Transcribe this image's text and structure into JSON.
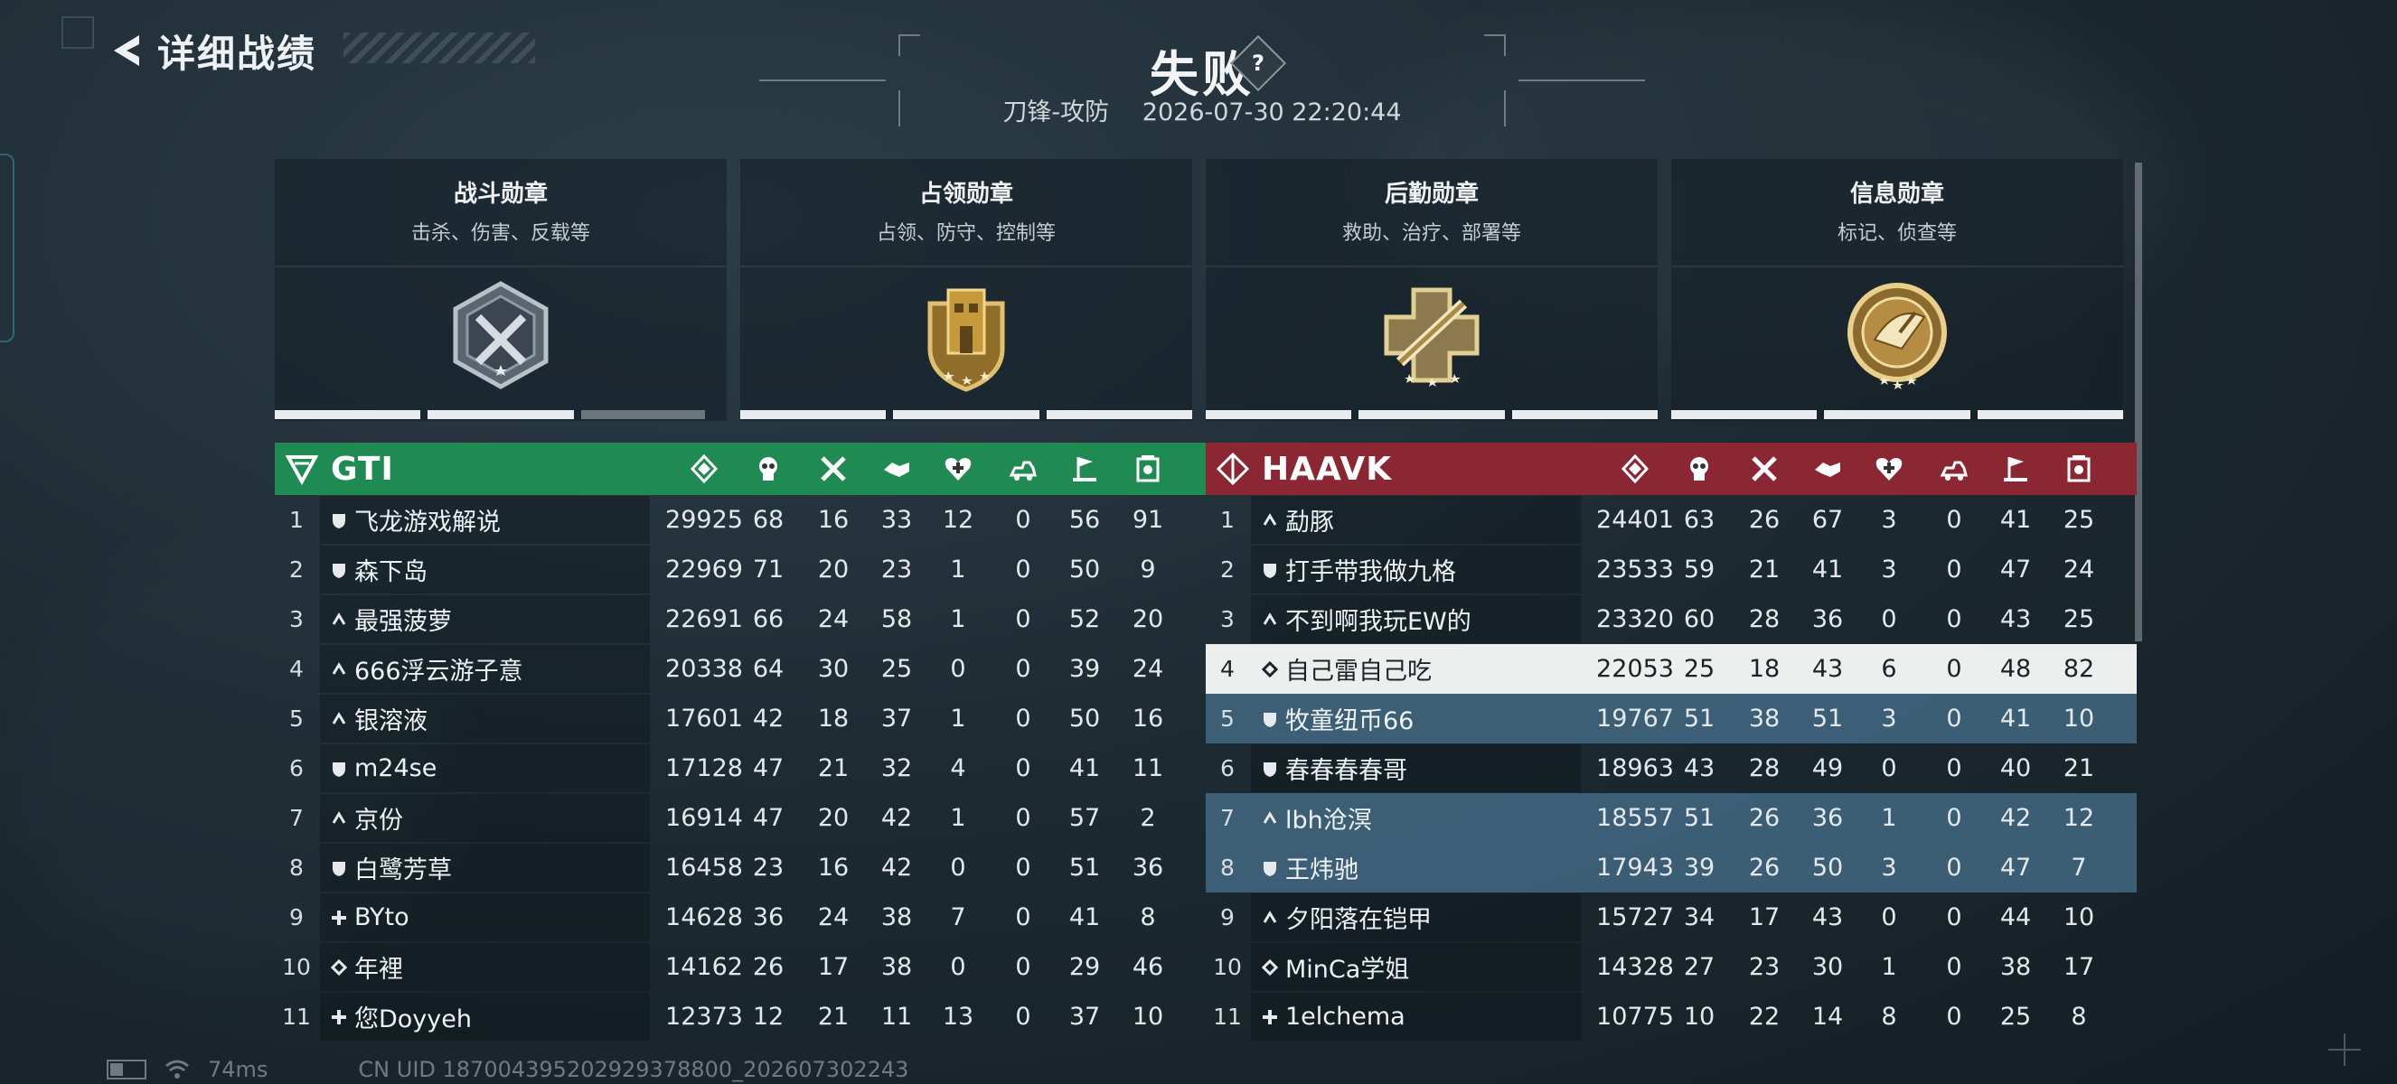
{
  "header": {
    "back_label": "详细战绩",
    "result": "失败",
    "help": "?",
    "mode": "刀锋-攻防",
    "datetime": "2026-07-30 22:20:44"
  },
  "medals": [
    {
      "title": "战斗勋章",
      "desc": "击杀、伤害、反载等",
      "icon": "combat-medal-icon",
      "progress": [
        1,
        1,
        0.85
      ]
    },
    {
      "title": "占领勋章",
      "desc": "占领、防守、控制等",
      "icon": "capture-medal-icon",
      "progress": [
        1,
        1,
        1
      ]
    },
    {
      "title": "后勤勋章",
      "desc": "救助、治疗、部署等",
      "icon": "logistics-medal-icon",
      "progress": [
        1,
        1,
        1
      ]
    },
    {
      "title": "信息勋章",
      "desc": "标记、侦查等",
      "icon": "intel-medal-icon",
      "progress": [
        1,
        1,
        1
      ]
    }
  ],
  "stat_icons": [
    "score-icon",
    "kill-icon",
    "death-icon",
    "assist-icon",
    "revive-icon",
    "vehicle-icon",
    "capture-icon",
    "intel-icon"
  ],
  "team_a": {
    "name": "GTI",
    "color": "#1f8a52",
    "players": [
      {
        "idx": "1",
        "rank": "shield",
        "name": "飞龙游戏解说",
        "stats": [
          "29925",
          "68",
          "16",
          "33",
          "12",
          "0",
          "56",
          "91"
        ]
      },
      {
        "idx": "2",
        "rank": "shield",
        "name": "森下岛",
        "stats": [
          "22969",
          "71",
          "20",
          "23",
          "1",
          "0",
          "50",
          "9"
        ]
      },
      {
        "idx": "3",
        "rank": "chevron",
        "name": "最强菠萝",
        "stats": [
          "22691",
          "66",
          "24",
          "58",
          "1",
          "0",
          "52",
          "20"
        ]
      },
      {
        "idx": "4",
        "rank": "chevron",
        "name": "666浮云游子意",
        "stats": [
          "20338",
          "64",
          "30",
          "25",
          "0",
          "0",
          "39",
          "24"
        ]
      },
      {
        "idx": "5",
        "rank": "chevron",
        "name": "银溶液",
        "stats": [
          "17601",
          "42",
          "18",
          "37",
          "1",
          "0",
          "50",
          "16"
        ]
      },
      {
        "idx": "6",
        "rank": "shield",
        "name": "m24se",
        "stats": [
          "17128",
          "47",
          "21",
          "32",
          "4",
          "0",
          "41",
          "11"
        ]
      },
      {
        "idx": "7",
        "rank": "chevron",
        "name": "京份",
        "stats": [
          "16914",
          "47",
          "20",
          "42",
          "1",
          "0",
          "57",
          "2"
        ]
      },
      {
        "idx": "8",
        "rank": "shield",
        "name": "白鹭芳草",
        "stats": [
          "16458",
          "23",
          "16",
          "42",
          "0",
          "0",
          "51",
          "36"
        ]
      },
      {
        "idx": "9",
        "rank": "cross",
        "name": "BYto",
        "stats": [
          "14628",
          "36",
          "24",
          "38",
          "7",
          "0",
          "41",
          "8"
        ]
      },
      {
        "idx": "10",
        "rank": "diamond",
        "name": "年裡",
        "stats": [
          "14162",
          "26",
          "17",
          "38",
          "0",
          "0",
          "29",
          "46"
        ]
      },
      {
        "idx": "11",
        "rank": "cross",
        "name": "您Doyyeh",
        "stats": [
          "12373",
          "12",
          "21",
          "11",
          "13",
          "0",
          "37",
          "10"
        ]
      }
    ]
  },
  "team_b": {
    "name": "HAAVK",
    "color": "#8a2733",
    "players": [
      {
        "idx": "1",
        "rank": "chevron",
        "name": "勐豚",
        "stats": [
          "24401",
          "63",
          "26",
          "67",
          "3",
          "0",
          "41",
          "25"
        ]
      },
      {
        "idx": "2",
        "rank": "shield",
        "name": "打手带我做九格",
        "stats": [
          "23533",
          "59",
          "21",
          "41",
          "3",
          "0",
          "47",
          "24"
        ]
      },
      {
        "idx": "3",
        "rank": "chevron",
        "name": "不到啊我玩EW的",
        "stats": [
          "23320",
          "60",
          "28",
          "36",
          "0",
          "0",
          "43",
          "25"
        ]
      },
      {
        "idx": "4",
        "rank": "diamond",
        "name": "自己雷自己吃",
        "stats": [
          "22053",
          "25",
          "18",
          "43",
          "6",
          "0",
          "48",
          "82"
        ],
        "highlight": true
      },
      {
        "idx": "5",
        "rank": "shield",
        "name": "牧童纽币66",
        "stats": [
          "19767",
          "51",
          "38",
          "51",
          "3",
          "0",
          "41",
          "10"
        ],
        "selected": true
      },
      {
        "idx": "6",
        "rank": "shield",
        "name": "春春春春哥",
        "stats": [
          "18963",
          "43",
          "28",
          "49",
          "0",
          "0",
          "40",
          "21"
        ]
      },
      {
        "idx": "7",
        "rank": "chevron",
        "name": "lbh沧溟",
        "stats": [
          "18557",
          "51",
          "26",
          "36",
          "1",
          "0",
          "42",
          "12"
        ],
        "selected": true
      },
      {
        "idx": "8",
        "rank": "shield",
        "name": "王炜驰",
        "stats": [
          "17943",
          "39",
          "26",
          "50",
          "3",
          "0",
          "47",
          "7"
        ],
        "selected": true
      },
      {
        "idx": "9",
        "rank": "chevron2",
        "name": "夕阳落在铠甲",
        "stats": [
          "15727",
          "34",
          "17",
          "43",
          "0",
          "0",
          "44",
          "10"
        ]
      },
      {
        "idx": "10",
        "rank": "diamond",
        "name": "MinCa学姐",
        "stats": [
          "14328",
          "27",
          "23",
          "30",
          "1",
          "0",
          "38",
          "17"
        ]
      },
      {
        "idx": "11",
        "rank": "cross",
        "name": "1elchema",
        "stats": [
          "10775",
          "10",
          "22",
          "14",
          "8",
          "0",
          "25",
          "8"
        ]
      }
    ]
  },
  "footer": {
    "ping": "74ms",
    "uid": "CN UID 187004395202929378800_202607302243"
  }
}
